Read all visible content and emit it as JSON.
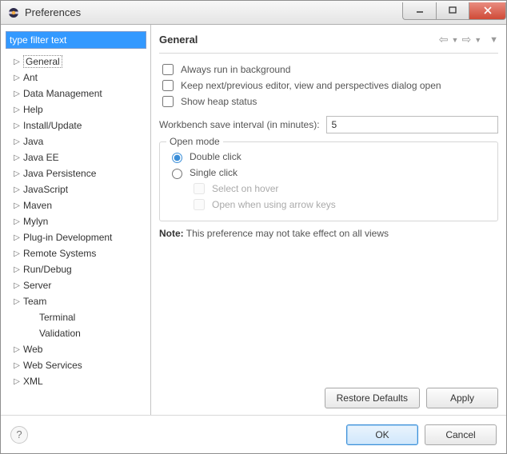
{
  "window": {
    "title": "Preferences"
  },
  "sidebar": {
    "filter_placeholder": "type filter text",
    "filter_value": "type filter text",
    "items": [
      {
        "label": "General",
        "expandable": true,
        "level": 0,
        "selected": true
      },
      {
        "label": "Ant",
        "expandable": true,
        "level": 0
      },
      {
        "label": "Data Management",
        "expandable": true,
        "level": 0
      },
      {
        "label": "Help",
        "expandable": true,
        "level": 0
      },
      {
        "label": "Install/Update",
        "expandable": true,
        "level": 0
      },
      {
        "label": "Java",
        "expandable": true,
        "level": 0
      },
      {
        "label": "Java EE",
        "expandable": true,
        "level": 0
      },
      {
        "label": "Java Persistence",
        "expandable": true,
        "level": 0
      },
      {
        "label": "JavaScript",
        "expandable": true,
        "level": 0
      },
      {
        "label": "Maven",
        "expandable": true,
        "level": 0
      },
      {
        "label": "Mylyn",
        "expandable": true,
        "level": 0
      },
      {
        "label": "Plug-in Development",
        "expandable": true,
        "level": 0
      },
      {
        "label": "Remote Systems",
        "expandable": true,
        "level": 0
      },
      {
        "label": "Run/Debug",
        "expandable": true,
        "level": 0
      },
      {
        "label": "Server",
        "expandable": true,
        "level": 0
      },
      {
        "label": "Team",
        "expandable": true,
        "level": 0
      },
      {
        "label": "Terminal",
        "expandable": false,
        "level": 1
      },
      {
        "label": "Validation",
        "expandable": false,
        "level": 1
      },
      {
        "label": "Web",
        "expandable": true,
        "level": 0
      },
      {
        "label": "Web Services",
        "expandable": true,
        "level": 0
      },
      {
        "label": "XML",
        "expandable": true,
        "level": 0
      }
    ]
  },
  "main": {
    "title": "General",
    "checks": {
      "always_bg": "Always run in background",
      "keep_dialog": "Keep next/previous editor, view and perspectives dialog open",
      "heap": "Show heap status"
    },
    "interval_label": "Workbench save interval (in minutes):",
    "interval_value": "5",
    "open_mode": {
      "legend": "Open mode",
      "double": "Double click",
      "single": "Single click",
      "hover": "Select on hover",
      "arrow": "Open when using arrow keys"
    },
    "note_label": "Note:",
    "note_text": " This preference may not take effect on all views",
    "restore": "Restore Defaults",
    "apply": "Apply"
  },
  "bottom": {
    "ok": "OK",
    "cancel": "Cancel"
  }
}
